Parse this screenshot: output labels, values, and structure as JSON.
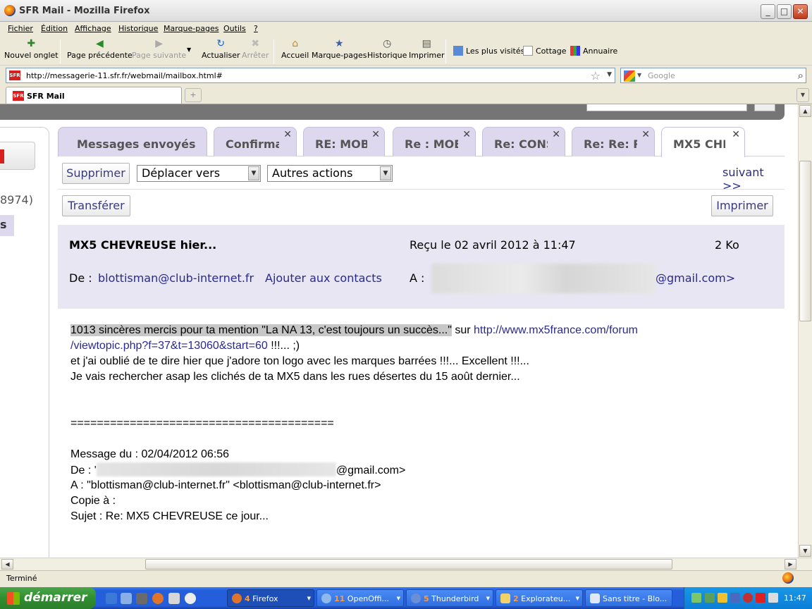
{
  "window": {
    "title": "SFR Mail - Mozilla Firefox"
  },
  "menu": [
    "Fichier",
    "Édition",
    "Affichage",
    "Historique",
    "Marque-pages",
    "Outils",
    "?"
  ],
  "toolbar": {
    "new_tab": "Nouvel onglet",
    "back": "Page précédente",
    "forward": "Page suivante",
    "reload": "Actualiser",
    "stop": "Arrêter",
    "home": "Accueil",
    "bookmarks": "Marque-pages",
    "history": "Historique",
    "print": "Imprimer"
  },
  "bookmarks_bar": [
    "Les plus visités",
    "Cottage",
    "Annuaire"
  ],
  "address": {
    "url": "http://messagerie-11.sfr.fr/webmail/mailbox.html#",
    "search_placeholder": "Google"
  },
  "browser_tab": {
    "label": "SFR Mail"
  },
  "webmail": {
    "folder_count": "8974)",
    "folder_selected": "s",
    "tabs": [
      {
        "label": "Messages envoyés",
        "closable": false
      },
      {
        "label": "Confirma",
        "closable": true
      },
      {
        "label": "RE: MOB",
        "closable": true
      },
      {
        "label": "Re : MOE",
        "closable": true
      },
      {
        "label": "Re: CONS",
        "closable": true
      },
      {
        "label": "Re: Re: R",
        "closable": true
      },
      {
        "label": "MX5 CHE",
        "closable": true,
        "active": true
      }
    ],
    "actions": {
      "delete": "Supprimer",
      "move": "Déplacer vers",
      "other": "Autres actions",
      "next": "suivant >>",
      "forward": "Transférer",
      "print": "Imprimer"
    },
    "header": {
      "subject": "MX5 CHEVREUSE hier...",
      "received": "Reçu le 02 avril 2012 à 11:47",
      "size": "2 Ko",
      "from_label": "De :",
      "from": "blottisman@club-internet.fr",
      "add_contact": "Ajouter aux contacts",
      "to_label": "A :",
      "to_suffix": "@gmail.com>"
    },
    "body": {
      "line1_highlight": "1013 sincères mercis pour ta mention \"La NA 13, c'est toujours un succès...\"",
      "line1_sur": " sur ",
      "line1_link": "http://www.mx5france.com/forum",
      "line2_link": "/viewtopic.php?f=37&t=13060&start=60",
      "line2_rest": " !!!...  ;)",
      "line3": "et j'ai oublié de te dire hier que j'adore ton logo avec les marques barrées !!!... Excellent !!!...",
      "line4": "Je vais rechercher asap les clichés de ta MX5 dans les rues désertes du 15 août dernier...",
      "separator": "========================================",
      "msg_date": "Message du : 02/04/2012 06:56",
      "msg_from_label": "De : '",
      "msg_from_suffix": "@gmail.com>",
      "msg_to": "A : \"blottisman@club-internet.fr\" <blottisman@club-internet.fr>",
      "msg_cc": "Copie à :",
      "msg_subject": "Sujet : Re: MX5 CHEVREUSE ce jour..."
    }
  },
  "status": {
    "text": "Terminé"
  },
  "taskbar": {
    "start": "démarrer",
    "tasks": [
      {
        "count": "4",
        "label": " Firefox"
      },
      {
        "count": "11",
        "label": " OpenOffi..."
      },
      {
        "count": "5",
        "label": " Thunderbird"
      },
      {
        "count": "2",
        "label": " Explorateu..."
      },
      {
        "count": "",
        "label": "Sans titre - Blo..."
      }
    ],
    "clock": "11:47"
  }
}
